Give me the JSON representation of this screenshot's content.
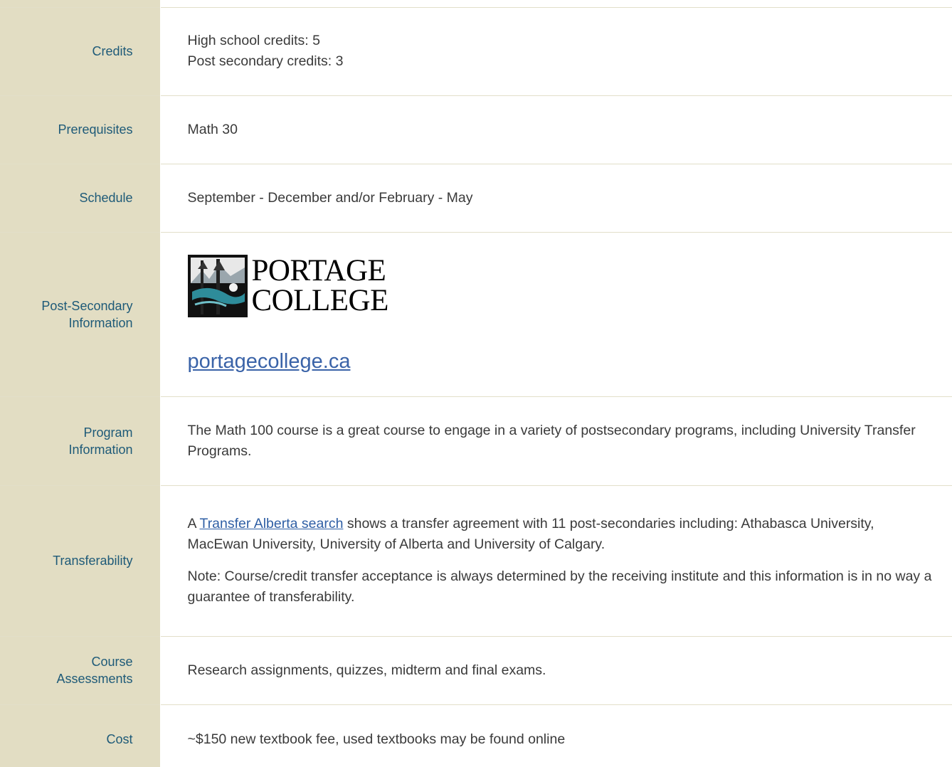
{
  "rows": [
    {
      "label": "Credits",
      "lines": [
        "High school credits: 5",
        "Post secondary credits: 3"
      ]
    },
    {
      "label": "Prerequisites",
      "value": "Math 30"
    },
    {
      "label": "Schedule",
      "value": "September - December and/or February - May"
    },
    {
      "label": "Post-Secondary Information",
      "logo": {
        "line1": "PORTAGE",
        "line2": "COLLEGE"
      },
      "link": "portagecollege.ca"
    },
    {
      "label": "Program Information",
      "value": "The Math 100 course is a great course to engage in a variety of postsecondary programs, including University Transfer Programs."
    },
    {
      "label": "Transferability",
      "para1_prefix": "A ",
      "para1_link": "Transfer Alberta search",
      "para1_suffix": " shows a transfer agreement with 11 post-secondaries including: Athabasca University, MacEwan University, University of Alberta and University of Calgary.",
      "para2": "Note: Course/credit transfer acceptance is always determined by the receiving institute and this information is in no way a guarantee of transferability."
    },
    {
      "label": "Course Assessments",
      "value": "Research assignments, quizzes, midterm and final exams."
    },
    {
      "label": "Cost",
      "value": "~$150 new textbook fee, used textbooks may be found online"
    }
  ]
}
